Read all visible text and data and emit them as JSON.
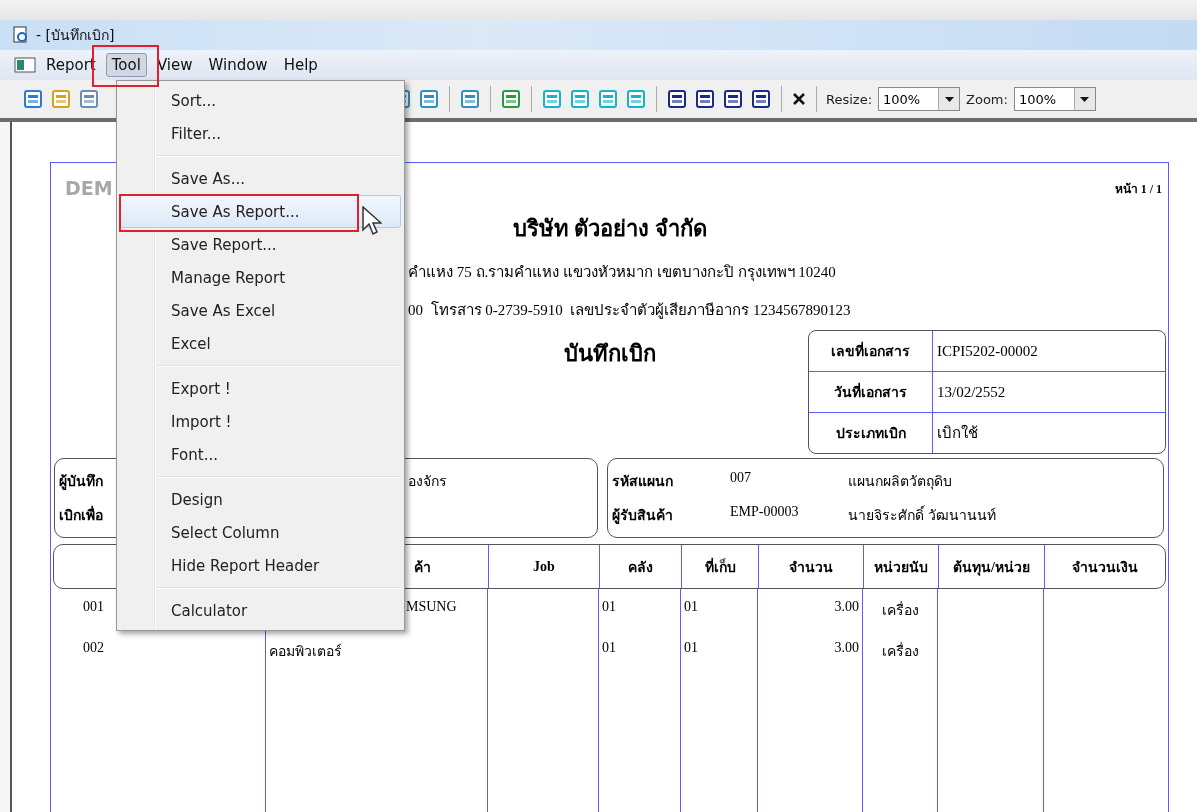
{
  "window": {
    "title": "- [บันทึกเบิก]"
  },
  "menubar": [
    {
      "label": "Report",
      "selected": false,
      "annotated": false
    },
    {
      "label": "Tool",
      "selected": true,
      "annotated": true
    },
    {
      "label": "View",
      "selected": false,
      "annotated": false
    },
    {
      "label": "Window",
      "selected": false,
      "annotated": false
    },
    {
      "label": "Help",
      "selected": false,
      "annotated": false
    }
  ],
  "toolbar": {
    "resize_label": "Resize:",
    "resize_value": "100%",
    "zoom_label": "Zoom:",
    "zoom_value": "100%"
  },
  "menu": [
    {
      "kind": "item",
      "label": "Sort...",
      "selected": false,
      "annotated": false
    },
    {
      "kind": "item",
      "label": "Filter...",
      "selected": false,
      "annotated": false
    },
    {
      "kind": "separator"
    },
    {
      "kind": "item",
      "label": "Save As...",
      "selected": false,
      "annotated": false
    },
    {
      "kind": "item",
      "label": "Save As Report...",
      "selected": true,
      "annotated": true
    },
    {
      "kind": "item",
      "label": "Save Report...",
      "selected": false,
      "annotated": false
    },
    {
      "kind": "item",
      "label": "Manage Report",
      "selected": false,
      "annotated": false
    },
    {
      "kind": "item",
      "label": "Save As Excel",
      "selected": false,
      "annotated": false
    },
    {
      "kind": "item",
      "label": "Excel",
      "selected": false,
      "annotated": false
    },
    {
      "kind": "separator"
    },
    {
      "kind": "item",
      "label": "Export !",
      "selected": false,
      "annotated": false
    },
    {
      "kind": "item",
      "label": "Import !",
      "selected": false,
      "annotated": false
    },
    {
      "kind": "item",
      "label": "Font...",
      "selected": false,
      "annotated": false
    },
    {
      "kind": "separator"
    },
    {
      "kind": "item",
      "label": "Design",
      "selected": false,
      "annotated": false
    },
    {
      "kind": "item",
      "label": "Select Column",
      "selected": false,
      "annotated": false
    },
    {
      "kind": "item",
      "label": "Hide Report Header",
      "selected": false,
      "annotated": false
    },
    {
      "kind": "separator"
    },
    {
      "kind": "item",
      "label": "Calculator",
      "selected": false,
      "annotated": false
    }
  ],
  "report": {
    "watermark": "DEM",
    "page": "หน้า 1 / 1",
    "company": "บริษัท ตัวอย่าง จำกัด",
    "address": "คำแหง 75 ถ.รามคำแหง แขวงหัวหมาก เขตบางกะปิ กรุงเทพฯ 10240",
    "tax_line": "00  โทรสาร 0-2739-5910  เลขประจำตัวผู้เสียภาษีอากร 1234567890123",
    "doc_title": "บันทึกเบิก",
    "doc_fields": [
      {
        "label": "เลขที่เอกสาร",
        "value": "ICPI5202-00002"
      },
      {
        "label": "วันที่เอกสาร",
        "value": "13/02/2552"
      },
      {
        "label": "ประเภทเบิก",
        "value": "เบิกใช้"
      }
    ],
    "left_info": [
      {
        "label": "ผู้บันทึก",
        "value": "องจักร"
      },
      {
        "label": "เบิกเพื่อ"
      }
    ],
    "right_info": [
      {
        "label": "รหัสแผนก",
        "code": "007",
        "name": "แผนกผลิตวัตถุดิบ"
      },
      {
        "label": "ผู้รับสินค้า",
        "code": "EMP-00003",
        "name": "นายจิระศักดิ์ วัฒนานนท์"
      }
    ],
    "columns": [
      "",
      "ค้า",
      "Job",
      "คลัง",
      "ที่เก็บ",
      "จำนวน",
      "หน่วยนับ",
      "ต้นทุน/หน่วย",
      "จำนวนเงิน"
    ],
    "rows": [
      [
        "001",
        "MSUNG",
        "",
        "01",
        "01",
        "3.00",
        "เครื่อง",
        "",
        ""
      ],
      [
        "002",
        "คอมพิวเตอร์",
        "",
        "01",
        "01",
        "3.00",
        "เครื่อง",
        "",
        ""
      ]
    ]
  }
}
